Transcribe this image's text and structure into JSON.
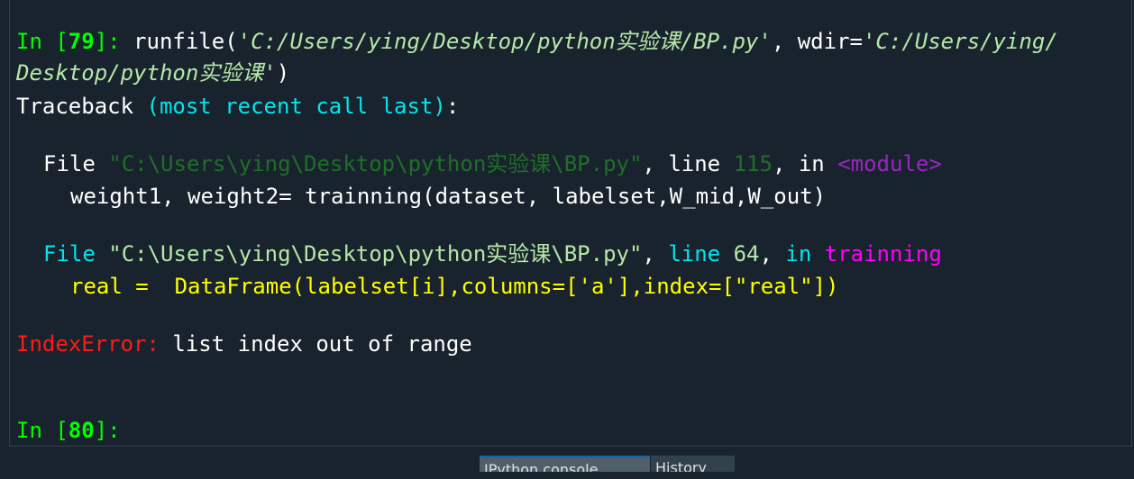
{
  "console": {
    "prompt_in": {
      "label": "In [",
      "number": "79",
      "close": "]:",
      "code_func": " runfile(",
      "code_path": "'C:/Users/ying/Desktop/python实验课/BP.py'",
      "code_sep": ", wdir=",
      "code_wdir_part1": "'C:/Users/ying/",
      "code_wdir_part2": "Desktop/python实验课'",
      "code_close": ")"
    },
    "traceback": {
      "title": "Traceback ",
      "subtitle": "(most recent call last)",
      "colon": ":",
      "frames": [
        {
          "file_label": "File ",
          "path": "\"C:\\Users\\ying\\Desktop\\python实验课\\BP.py\"",
          "comma": ", ",
          "line_label": "line ",
          "line_number": "115",
          "in_sep": ", ",
          "in_label": "in ",
          "func": "<module>",
          "source": "weight1, weight2= trainning(dataset, labelset,W_mid,W_out)"
        },
        {
          "file_label": "File ",
          "path": "\"C:\\Users\\ying\\Desktop\\python实验课\\BP.py\"",
          "comma": ", ",
          "line_label": "line ",
          "line_number": "64",
          "in_sep": ", ",
          "in_label": "in ",
          "func": "trainning",
          "source": "real =  DataFrame(labelset[i],columns=['a'],index=[\"real\"])"
        }
      ],
      "error_type": "IndexError:",
      "error_message": " list index out of range"
    },
    "prompt_next": {
      "label": "In [",
      "number": "80",
      "close": "]:"
    }
  },
  "tabs": [
    {
      "label": "IPython console",
      "active": true
    },
    {
      "label": "History",
      "active": false
    }
  ],
  "colors": {
    "background": "#19232d",
    "prompt": "#00ff00",
    "keyword_cyan": "#00e5ee",
    "string": "#b5e8a8",
    "error": "#ff1a1a",
    "function_name": "#ff00ff",
    "source_line": "#ffff00"
  }
}
